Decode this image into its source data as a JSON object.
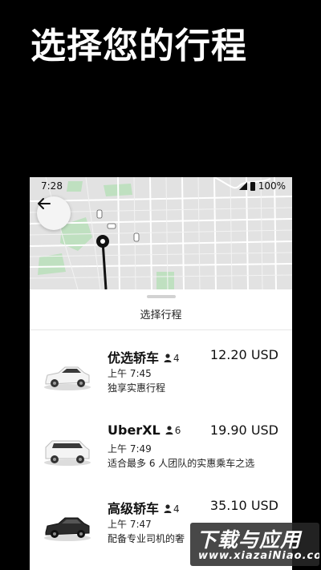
{
  "headline": "选择您的行程",
  "status_bar": {
    "time": "7:28",
    "battery": "100%"
  },
  "map": {
    "back_icon": "arrow-left-icon"
  },
  "sheet": {
    "title": "选择行程"
  },
  "rides": [
    {
      "name": "优选轿车",
      "capacity": "4",
      "price": "12.20 USD",
      "eta": "上午 7:45",
      "description": "独享实惠行程",
      "car_color": "#f2f2f2"
    },
    {
      "name": "UberXL",
      "capacity": "6",
      "price": "19.90 USD",
      "eta": "上午 7:49",
      "description": "适合最多 6 人团队的实惠乘车之选",
      "car_color": "#f2f2f2"
    },
    {
      "name": "高级轿车",
      "capacity": "4",
      "price": "35.10 USD",
      "eta": "上午 7:47",
      "description": "配备专业司机的奢",
      "car_color": "#2b2b2b"
    }
  ],
  "watermark": {
    "main": "下载与应用",
    "sub": "www.xiazaiNiao.com"
  }
}
